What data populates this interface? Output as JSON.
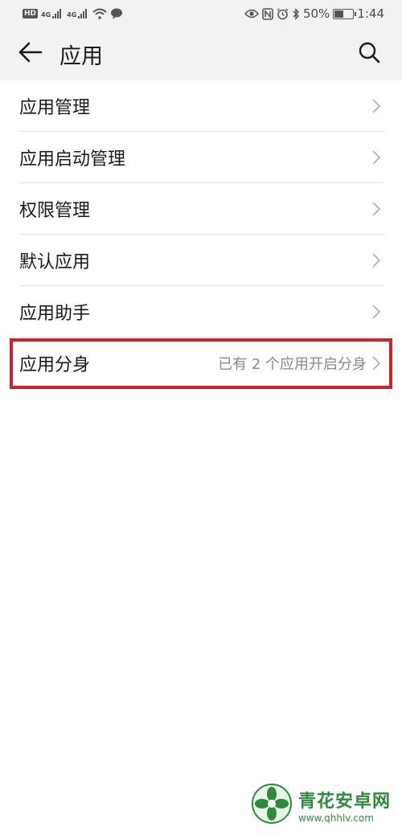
{
  "status_bar": {
    "hd": "HD",
    "net1": "4G",
    "net2": "4G",
    "battery_percent": "50%",
    "time": "1:44",
    "battery_level": 0.5
  },
  "header": {
    "title": "应用"
  },
  "menu": {
    "items": [
      {
        "label": "应用管理",
        "value": ""
      },
      {
        "label": "应用启动管理",
        "value": ""
      },
      {
        "label": "权限管理",
        "value": ""
      },
      {
        "label": "默认应用",
        "value": ""
      },
      {
        "label": "应用助手",
        "value": ""
      },
      {
        "label": "应用分身",
        "value": "已有 2 个应用开启分身"
      }
    ]
  },
  "watermark": {
    "name": "青花安卓网",
    "url": "www.qhhlv.com"
  },
  "colors": {
    "highlight": "#d0202a",
    "header_bg": "#f2f2f2",
    "watermark": "#2e8b3e"
  }
}
